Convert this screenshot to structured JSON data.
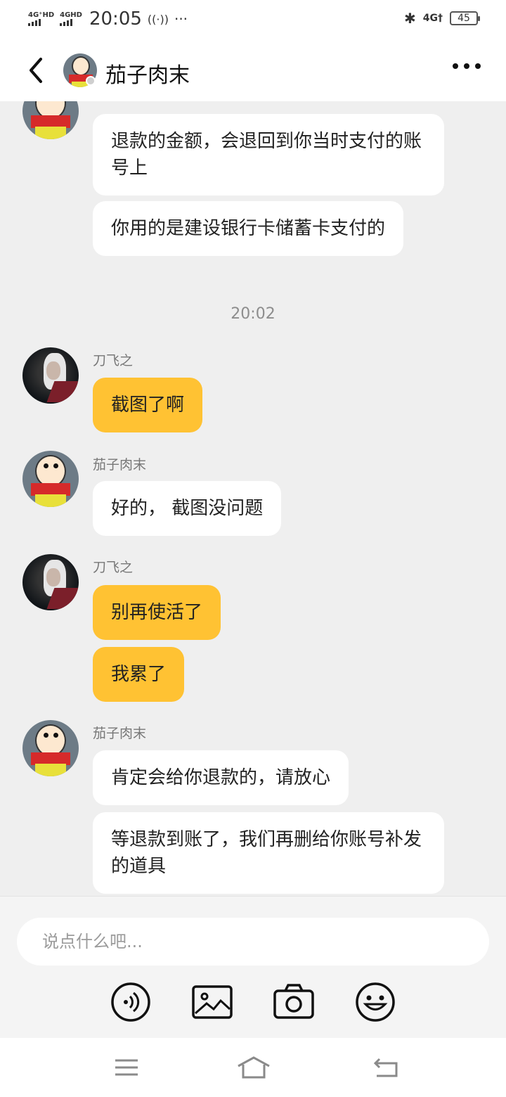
{
  "status_bar": {
    "network1": "4G⁺HD",
    "network2": "4GHD",
    "time": "20:05",
    "dots": "···",
    "right_network": "4G†",
    "battery": "45"
  },
  "header": {
    "title": "茄子肉末"
  },
  "chat": {
    "messages_top": [
      {
        "text": "退款的金额，会退回到你当时支付的账号上"
      },
      {
        "text": "你用的是建设银行卡储蓄卡支付的"
      }
    ],
    "timestamp": "20:02",
    "groups": [
      {
        "sender": "刀飞之",
        "messages": [
          "截图了啊"
        ]
      },
      {
        "sender": "茄子肉末",
        "messages": [
          "好的， 截图没问题"
        ]
      },
      {
        "sender": "刀飞之",
        "messages": [
          "别再使活了",
          "我累了"
        ]
      },
      {
        "sender": "茄子肉末",
        "messages": [
          "肯定会给你退款的，请放心",
          "等退款到账了，我们再删给你账号补发的道具"
        ]
      }
    ]
  },
  "composer": {
    "placeholder": "说点什么吧..."
  },
  "icons": {
    "voice": "voice-icon",
    "image": "image-icon",
    "camera": "camera-icon",
    "emoji": "emoji-icon"
  },
  "colors": {
    "accent_bubble": "#ffc233",
    "background": "#efefef"
  }
}
